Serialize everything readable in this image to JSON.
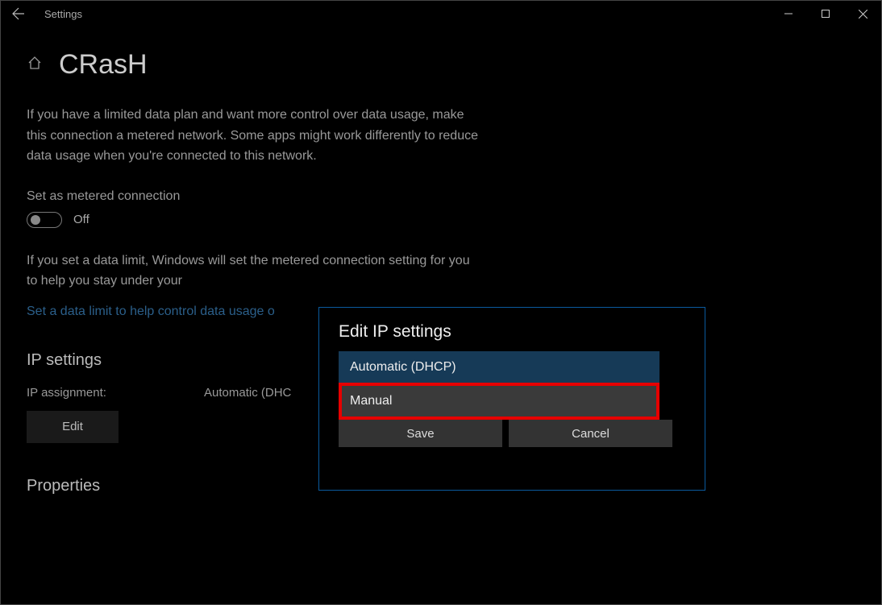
{
  "titlebar": {
    "app_name": "Settings"
  },
  "header": {
    "page_title": "CRasH"
  },
  "main": {
    "description": "If you have a limited data plan and want more control over data usage, make this connection a metered network. Some apps might work differently to reduce data usage when you're connected to this network.",
    "metered_label": "Set as metered connection",
    "metered_state": "Off",
    "data_limit_text": "If you set a data limit, Windows will set the metered connection setting for you to help you stay under your ",
    "data_limit_link": "Set a data limit to help control data usage o",
    "ip_heading": "IP settings",
    "ip_assignment_label": "IP assignment:",
    "ip_assignment_value": "Automatic (DHC",
    "edit_label": "Edit",
    "properties_heading": "Properties"
  },
  "dialog": {
    "title": "Edit IP settings",
    "option_automatic": "Automatic (DHCP)",
    "option_manual": "Manual",
    "save_label": "Save",
    "cancel_label": "Cancel"
  }
}
